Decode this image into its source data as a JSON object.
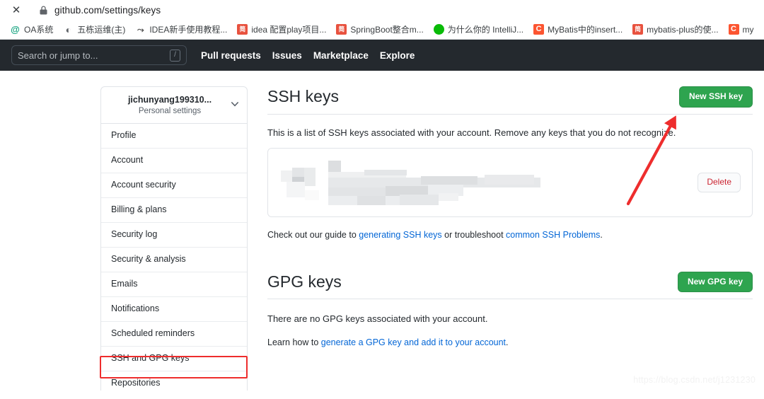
{
  "browser": {
    "close_label": "✕",
    "lock_icon": "lock-icon",
    "url": "github.com/settings/keys",
    "bookmarks": [
      {
        "label": "OA系统",
        "icon": "at-icon",
        "icon_class": "ico-at",
        "glyph": "@"
      },
      {
        "label": "五栋运维(主)",
        "icon": "globe-icon",
        "icon_class": "ico-globe",
        "glyph": "◐"
      },
      {
        "label": "IDEA新手使用教程...",
        "icon": "idea-icon",
        "icon_class": "ico-idea",
        "glyph": "⤳"
      },
      {
        "label": "idea 配置play项目...",
        "icon": "jianshu-icon",
        "icon_class": "ico-jian",
        "glyph": "简"
      },
      {
        "label": "SpringBoot整合m...",
        "icon": "jianshu-icon",
        "icon_class": "ico-jian",
        "glyph": "简"
      },
      {
        "label": "为什么你的 IntelliJ...",
        "icon": "wechat-icon",
        "icon_class": "ico-wechat",
        "glyph": ""
      },
      {
        "label": "MyBatis中的insert...",
        "icon": "csdn-icon",
        "icon_class": "ico-csdn",
        "glyph": "C"
      },
      {
        "label": "mybatis-plus的使...",
        "icon": "jianshu-icon",
        "icon_class": "ico-jian",
        "glyph": "简"
      },
      {
        "label": "my",
        "icon": "csdn-icon",
        "icon_class": "ico-csdn",
        "glyph": "C"
      }
    ]
  },
  "gh_header": {
    "search_placeholder": "Search or jump to...",
    "search_value": "",
    "slash_hint": "/",
    "nav": [
      {
        "label": "Pull requests"
      },
      {
        "label": "Issues"
      },
      {
        "label": "Marketplace"
      },
      {
        "label": "Explore"
      }
    ]
  },
  "sidebar": {
    "username": "jichunyang199310...",
    "subtitle": "Personal settings",
    "caret_icon": "chevron-down-icon",
    "items": [
      {
        "label": "Profile",
        "selected": false
      },
      {
        "label": "Account",
        "selected": false
      },
      {
        "label": "Account security",
        "selected": false
      },
      {
        "label": "Billing & plans",
        "selected": false
      },
      {
        "label": "Security log",
        "selected": false
      },
      {
        "label": "Security & analysis",
        "selected": false
      },
      {
        "label": "Emails",
        "selected": false
      },
      {
        "label": "Notifications",
        "selected": false
      },
      {
        "label": "Scheduled reminders",
        "selected": false
      },
      {
        "label": "SSH and GPG keys",
        "selected": true
      },
      {
        "label": "Repositories",
        "selected": false
      }
    ]
  },
  "ssh_section": {
    "title": "SSH keys",
    "new_key_button": "New SSH key",
    "description": "This is a list of SSH keys associated with your account. Remove any keys that you do not recognize.",
    "key_row": {
      "content": "",
      "redacted": true,
      "delete_button": "Delete"
    },
    "guide_prefix": "Check out our guide to ",
    "guide_link_1": "generating SSH keys",
    "guide_middle": " or troubleshoot ",
    "guide_link_2": "common SSH Problems",
    "guide_suffix": "."
  },
  "gpg_section": {
    "title": "GPG keys",
    "new_key_button": "New GPG key",
    "description": "There are no GPG keys associated with your account.",
    "learn_prefix": "Learn how to ",
    "learn_link": "generate a GPG key and add it to your account",
    "learn_suffix": "."
  },
  "annotations": {
    "arrow_color": "#ee2d2d",
    "highlight_box_color": "#ee2d2d",
    "highlight_target": "SSH and GPG keys"
  },
  "watermark": "https://blog.csdn.net/j1231230",
  "colors": {
    "header_bg": "#24292e",
    "accent_green": "#2ea44f",
    "link_blue": "#0366d6",
    "danger_red": "#cb2431",
    "annotation_red": "#ee2d2d",
    "border": "#e1e4e8"
  }
}
